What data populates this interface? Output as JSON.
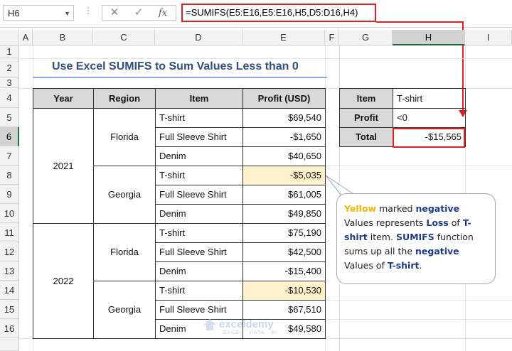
{
  "formula_bar": {
    "name_box": "H6",
    "dots": "⋮",
    "cancel": "✕",
    "enter": "✓",
    "fx": "fx",
    "formula": "=SUMIFS(E5:E16,E5:E16,H5,D5:D16,H4)"
  },
  "columns": [
    "A",
    "B",
    "C",
    "D",
    "E",
    "F",
    "G",
    "H",
    "I"
  ],
  "rows": [
    "1",
    "2",
    "3",
    "4",
    "5",
    "6",
    "7",
    "8",
    "9",
    "10",
    "11",
    "12",
    "13",
    "14",
    "15",
    "16"
  ],
  "title": "Use Excel SUMIFS to Sum Values Less than 0",
  "table": {
    "headers": [
      "Year",
      "Region",
      "Item",
      "Profit (USD)"
    ],
    "years": [
      "2021",
      "2022"
    ],
    "regions": [
      "Florida",
      "Georgia",
      "Florida",
      "Georgia"
    ],
    "items": [
      "T-shirt",
      "Full Sleeve Shirt",
      "Denim",
      "T-shirt",
      "Full Sleeve Shirt",
      "Denim",
      "T-shirt",
      "Full Sleeve Shirt",
      "Denim",
      "T-shirt",
      "Full Sleeve Shirt",
      "Denim"
    ],
    "profits": [
      "$69,540",
      "-$1,650",
      "$40,650",
      "-$5,035",
      "$61,005",
      "$49,850",
      "$75,190",
      "$42,500",
      "-$15,400",
      "-$10,530",
      "$67,510",
      "$49,580"
    ]
  },
  "criteria": {
    "item_label": "Item",
    "item_value": "T-shirt",
    "profit_label": "Profit",
    "profit_value": "<0",
    "total_label": "Total",
    "total_value": "-$15,565"
  },
  "callout": {
    "w1": "Yellow",
    "w2": " marked ",
    "w3": "negative",
    "w4": " Values represents ",
    "w5": "Loss",
    "w6": " of ",
    "w7": "T-shirt",
    "w8": " item. ",
    "w9": "SUMIFS",
    "w10": " function sums up all the ",
    "w11": "negative",
    "w12": " Values of ",
    "w13": "T-shirt",
    "w14": "."
  },
  "watermark": {
    "name": "exceldemy",
    "tagline": "EXCEL · DATA · BI"
  },
  "colors": {
    "red": "#e02020",
    "yellow_fill": "#fff2cc",
    "header_fill": "#d9d9d9",
    "title": "#2f4f7f"
  }
}
